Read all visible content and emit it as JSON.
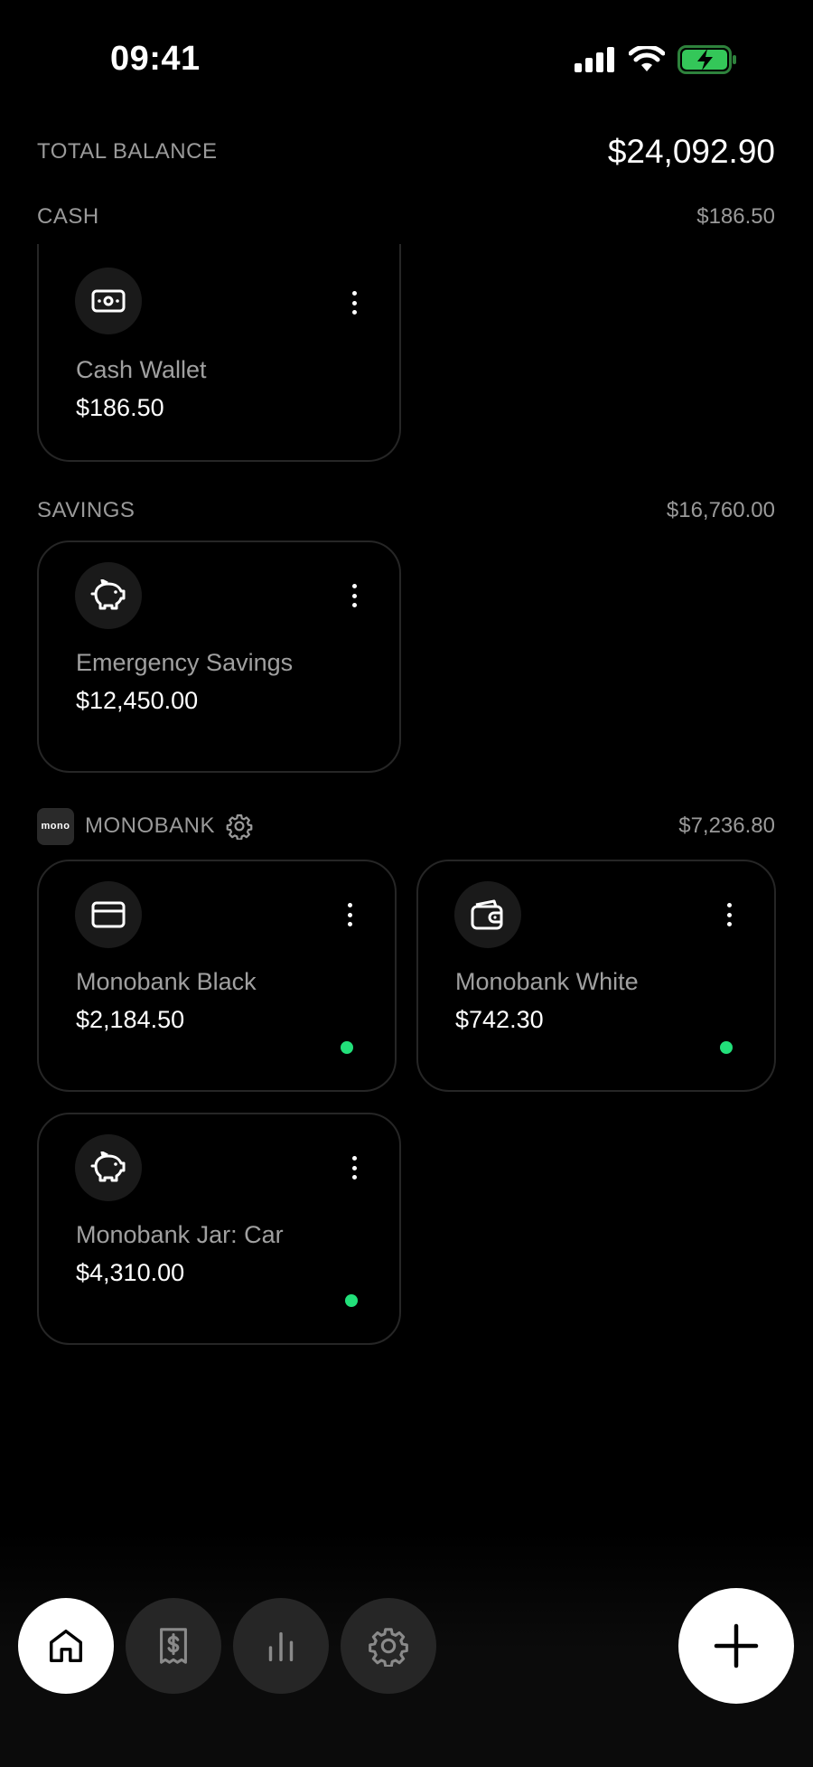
{
  "status_bar": {
    "time": "09:41"
  },
  "total": {
    "label": "TOTAL BALANCE",
    "value": "$24,092.90"
  },
  "sections": {
    "cash": {
      "title": "CASH",
      "total": "$186.50",
      "accounts": [
        {
          "name": "Cash Wallet",
          "amount": "$186.50",
          "icon": "cash-icon"
        }
      ]
    },
    "savings": {
      "title": "SAVINGS",
      "total": "$16,760.00",
      "accounts": [
        {
          "name": "Emergency Savings",
          "amount": "$12,450.00",
          "icon": "piggy-bank-icon"
        }
      ]
    },
    "monobank": {
      "title": "MONOBANK",
      "badge": "mono",
      "total": "$7,236.80",
      "accounts": [
        {
          "name": "Monobank Black",
          "amount": "$2,184.50",
          "icon": "credit-card-icon",
          "synced": true
        },
        {
          "name": "Monobank White",
          "amount": "$742.30",
          "icon": "wallet-icon",
          "synced": true
        },
        {
          "name": "Monobank Jar: Car",
          "amount": "$4,310.00",
          "icon": "piggy-bank-icon",
          "synced": true
        }
      ]
    }
  },
  "nav": {
    "items": [
      {
        "icon": "home-icon",
        "active": true
      },
      {
        "icon": "receipt-icon",
        "active": false
      },
      {
        "icon": "bar-chart-icon",
        "active": false
      },
      {
        "icon": "gear-icon",
        "active": false
      }
    ]
  },
  "colors": {
    "accent_sync": "#22e07a",
    "background": "#000000",
    "muted_text": "#9a9a9a"
  }
}
